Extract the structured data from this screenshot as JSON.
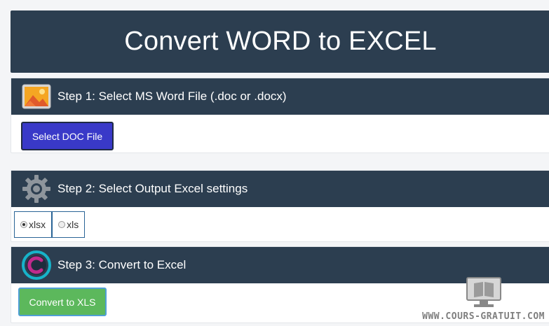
{
  "header": {
    "title": "Convert WORD to EXCEL"
  },
  "step1": {
    "title": "Step 1: Select MS Word File (.doc or .docx)",
    "icon": "image-icon",
    "button_label": "Select DOC File"
  },
  "step2": {
    "title": "Step 2: Select Output Excel settings",
    "icon": "gear-icon",
    "options": [
      {
        "label": "xlsx",
        "checked": true
      },
      {
        "label": "xls",
        "checked": false
      }
    ]
  },
  "step3": {
    "title": "Step 3: Convert to Excel",
    "icon": "c-logo-icon",
    "button_label": "Convert to XLS"
  },
  "watermark": {
    "text": "WWW.COURS-GRATUIT.COM"
  },
  "colors": {
    "header_bg": "#2c3e50",
    "doc_button": "#3939c8",
    "xls_button": "#5cb85c",
    "logo_ring": "#17b3c9",
    "logo_c": "#c02a8c"
  }
}
